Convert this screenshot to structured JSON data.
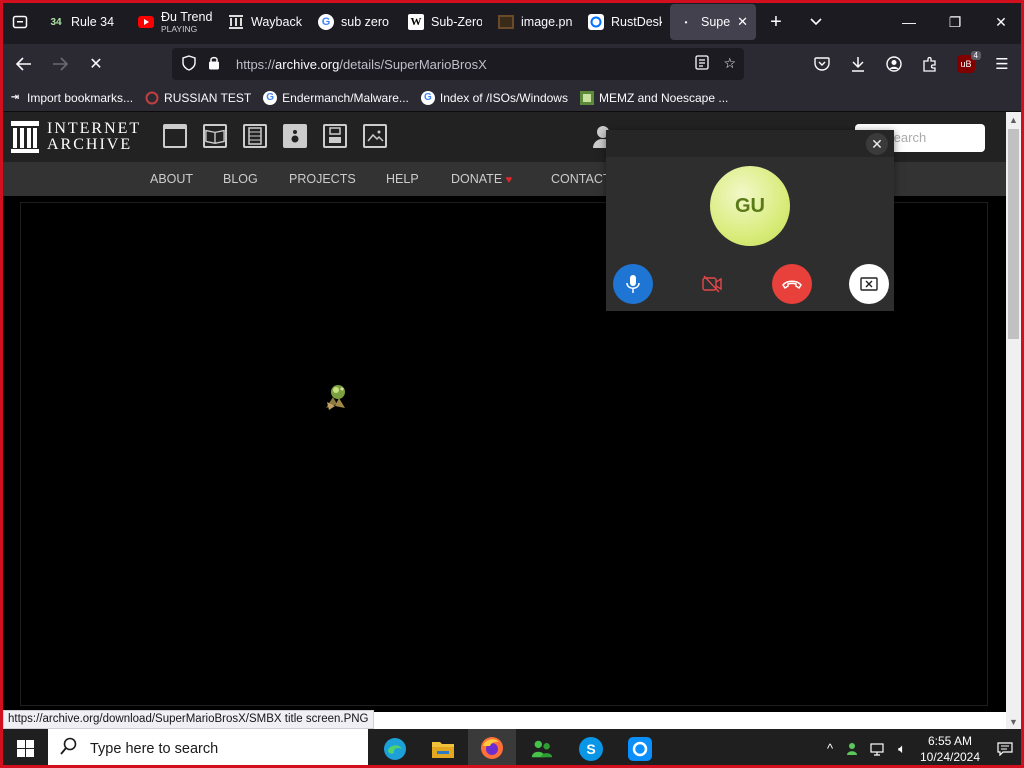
{
  "tabs": [
    {
      "title": "Rule 34",
      "icon": "rule34-favicon"
    },
    {
      "title": "Đu Trend",
      "subtitle": "PLAYING",
      "icon": "youtube-favicon"
    },
    {
      "title": "Wayback",
      "icon": "internet-archive-favicon"
    },
    {
      "title": "sub zero",
      "icon": "google-favicon"
    },
    {
      "title": "Sub-Zero",
      "icon": "wikipedia-favicon"
    },
    {
      "title": "image.pn",
      "icon": "image-favicon"
    },
    {
      "title": "RustDesk",
      "icon": "rustdesk-favicon"
    },
    {
      "title": "Super",
      "icon": "loading-favicon",
      "active": true
    }
  ],
  "address": {
    "prefix": "https://",
    "domain": "archive.org",
    "path": "/details/SuperMarioBrosX"
  },
  "bookmarks": [
    {
      "label": "Import bookmarks...",
      "icon": "import-icon"
    },
    {
      "label": "RUSSIAN TEST",
      "icon": "russian-test-favicon"
    },
    {
      "label": "Endermanch/Malware...",
      "icon": "google-favicon"
    },
    {
      "label": "Index of /ISOs/Windows",
      "icon": "google-favicon"
    },
    {
      "label": "MEMZ and Noescape ...",
      "icon": "memz-favicon"
    }
  ],
  "extensions_badge": "4",
  "ia": {
    "logo_line1": "INTERNET",
    "logo_line2": "ARCHIVE",
    "search_placeholder": "Search",
    "nav": [
      "ABOUT",
      "BLOG",
      "PROJECTS",
      "HELP",
      "DONATE",
      "CONTACT"
    ]
  },
  "status_url": "https://archive.org/download/SuperMarioBrosX/SMBX title screen.PNG",
  "call": {
    "avatar_initials": "GU"
  },
  "taskbar": {
    "search_placeholder": "Type here to search",
    "apps": [
      "edge",
      "file-explorer",
      "firefox",
      "people",
      "skype",
      "rustdesk"
    ],
    "time": "6:55 AM",
    "date": "10/24/2024"
  },
  "colors": {
    "frame_border": "#d10f1f",
    "browser_dark": "#1c1b22",
    "toolbar": "#2b2a33",
    "ia_header": "#222222",
    "call_mic": "#1f75d4",
    "call_hangup": "#e8403b",
    "call_avatar": "#d9ec7c"
  }
}
